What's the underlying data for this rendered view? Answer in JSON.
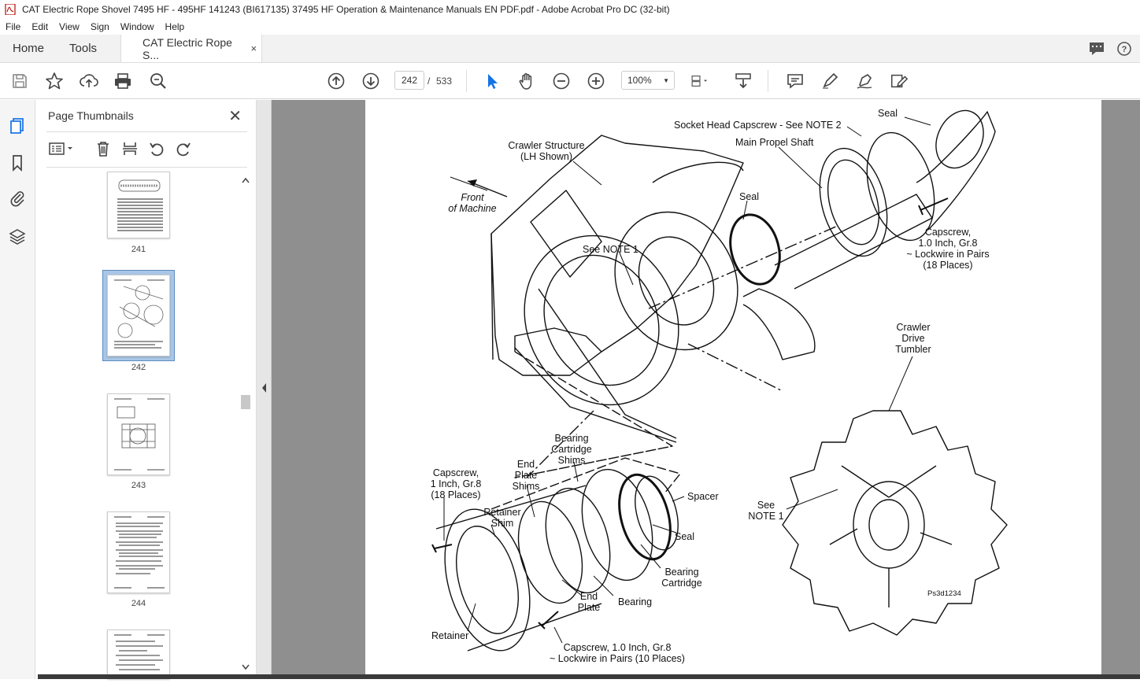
{
  "window": {
    "title": "CAT Electric Rope Shovel 7495 HF - 495HF 141243 (BI617135) 37495 HF Operation & Maintenance Manuals EN PDF.pdf - Adobe Acrobat Pro DC (32-bit)"
  },
  "menu": [
    "File",
    "Edit",
    "View",
    "Sign",
    "Window",
    "Help"
  ],
  "tabs": {
    "home": "Home",
    "tools": "Tools",
    "document": "CAT Electric Rope S...",
    "close": "×"
  },
  "toolbar": {
    "current_page": "242",
    "page_separator": "/",
    "total_pages": "533",
    "zoom": "100%"
  },
  "thumbnails": {
    "title": "Page Thumbnails",
    "close": "✕",
    "pages": [
      "241",
      "242",
      "243",
      "244"
    ],
    "selected": "242"
  },
  "diagram": {
    "labels": {
      "seal_top": "Seal",
      "socket_head": "Socket Head Capscrew - See NOTE 2",
      "main_propel": "Main Propel Shaft",
      "crawler_structure_1": "Crawler Structure",
      "crawler_structure_2": "(LH Shown)",
      "front_1": "Front",
      "front_2": "of Machine",
      "seal_mid": "Seal",
      "capscrew_r_1": "Capscrew,",
      "capscrew_r_2": "1.0 Inch, Gr.8",
      "capscrew_r_3": "~ Lockwire in Pairs",
      "capscrew_r_4": "(18 Places)",
      "see_note1": "See NOTE 1",
      "crawler_drive_1": "Crawler",
      "crawler_drive_2": "Drive",
      "crawler_drive_3": "Tumbler",
      "bearing_shims_1": "Bearing",
      "bearing_shims_2": "Cartridge",
      "bearing_shims_3": "Shims",
      "end_plate_shims_1": "End",
      "end_plate_shims_2": "Plate",
      "end_plate_shims_3": "Shims",
      "capscrew_l_1": "Capscrew,",
      "capscrew_l_2": "1 Inch, Gr.8",
      "capscrew_l_3": "(18 Places)",
      "retainer_shim_1": "Retainer",
      "retainer_shim_2": "Shim",
      "spacer": "Spacer",
      "see_note1_b_1": "See",
      "see_note1_b_2": "NOTE 1",
      "seal_low": "Seal",
      "bearing_cart_1": "Bearing",
      "bearing_cart_2": "Cartridge",
      "end_plate_1": "End",
      "end_plate_2": "Plate",
      "bearing": "Bearing",
      "retainer": "Retainer",
      "capscrew_b_1": "Capscrew, 1.0 Inch, Gr.8",
      "capscrew_b_2": "~ Lockwire in Pairs (10 Places)",
      "figure_id": "Ps3d1234"
    }
  }
}
